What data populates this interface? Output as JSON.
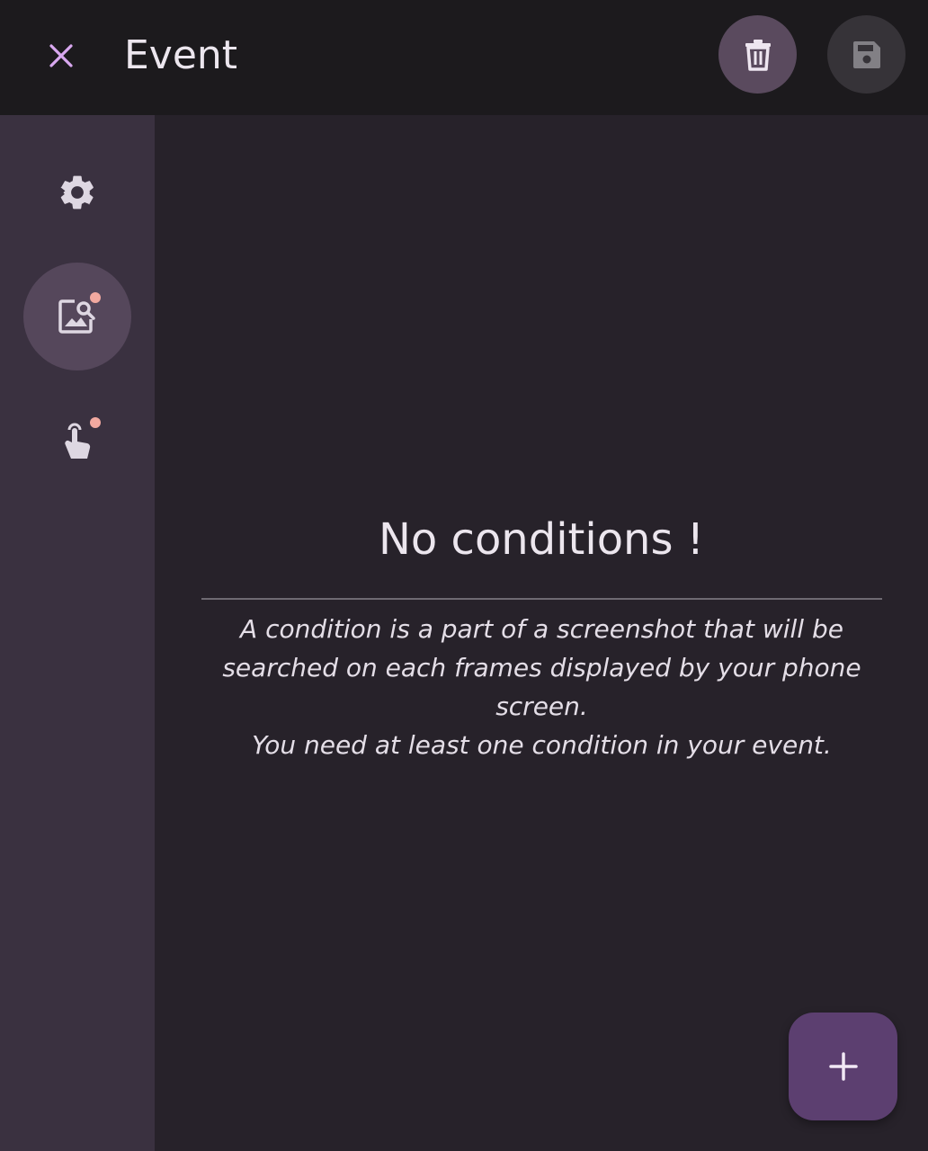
{
  "header": {
    "title": "Event",
    "close_icon": "close-icon",
    "delete_icon": "trash-icon",
    "save_icon": "save-icon"
  },
  "sidebar": {
    "items": [
      {
        "id": "settings",
        "icon": "gear-icon",
        "active": false,
        "badge": false
      },
      {
        "id": "conditions",
        "icon": "image-search-icon",
        "active": true,
        "badge": true
      },
      {
        "id": "actions",
        "icon": "touch-icon",
        "active": false,
        "badge": true
      }
    ]
  },
  "empty_state": {
    "title": "No conditions !",
    "description_line1": "A condition is a part of a screenshot that will be searched on each frames displayed by your phone screen.",
    "description_line2": "You need at least one condition in your event."
  },
  "fab": {
    "icon": "plus-icon"
  },
  "colors": {
    "topbar": "#1c1a1d",
    "background": "#27222a",
    "sidebar": "#3a3140",
    "accent": "#5c3f70",
    "badge": "#f2a9a0",
    "close_icon": "#d9a8f0"
  }
}
